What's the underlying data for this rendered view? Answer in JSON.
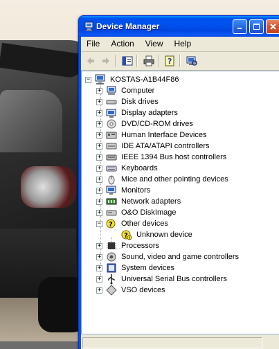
{
  "window": {
    "title": "Device Manager",
    "controls": [
      "minimize",
      "maximize",
      "close"
    ]
  },
  "menu": [
    "File",
    "Action",
    "View",
    "Help"
  ],
  "toolbar": {
    "buttons": [
      "back-icon",
      "forward-icon",
      "show-hide-tree-icon",
      "print-icon",
      "help-icon",
      "scan-hardware-icon"
    ]
  },
  "tree": {
    "root": "KOSTAS-A1B44F86",
    "categories": [
      {
        "label": "Computer",
        "icon": "computer-icon",
        "expanded": false
      },
      {
        "label": "Disk drives",
        "icon": "disk-drive-icon",
        "expanded": false
      },
      {
        "label": "Display adapters",
        "icon": "display-adapter-icon",
        "expanded": false
      },
      {
        "label": "DVD/CD-ROM drives",
        "icon": "cdrom-icon",
        "expanded": false
      },
      {
        "label": "Human Interface Devices",
        "icon": "hid-icon",
        "expanded": false
      },
      {
        "label": "IDE ATA/ATAPI controllers",
        "icon": "ide-controller-icon",
        "expanded": false
      },
      {
        "label": "IEEE 1394 Bus host controllers",
        "icon": "firewire-icon",
        "expanded": false
      },
      {
        "label": "Keyboards",
        "icon": "keyboard-icon",
        "expanded": false
      },
      {
        "label": "Mice and other pointing devices",
        "icon": "mouse-icon",
        "expanded": false
      },
      {
        "label": "Monitors",
        "icon": "monitor-icon",
        "expanded": false
      },
      {
        "label": "Network adapters",
        "icon": "network-adapter-icon",
        "expanded": false
      },
      {
        "label": "O&O DiskImage",
        "icon": "diskimage-icon",
        "expanded": false
      },
      {
        "label": "Other devices",
        "icon": "unknown-device-icon",
        "expanded": true,
        "children": [
          "Unknown device"
        ]
      },
      {
        "label": "Processors",
        "icon": "processor-icon",
        "expanded": false
      },
      {
        "label": "Sound, video and game controllers",
        "icon": "sound-icon",
        "expanded": false
      },
      {
        "label": "System devices",
        "icon": "system-device-icon",
        "expanded": false
      },
      {
        "label": "Universal Serial Bus controllers",
        "icon": "usb-icon",
        "expanded": false
      },
      {
        "label": "VSO devices",
        "icon": "vso-icon",
        "expanded": false
      }
    ]
  },
  "colors": {
    "titlebar": "#0054e3",
    "chrome": "#ece9d8",
    "tree_bg": "#ffffff"
  }
}
